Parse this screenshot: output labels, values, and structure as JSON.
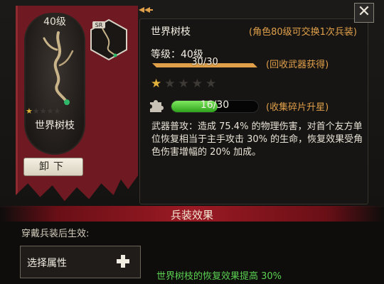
{
  "banner": {
    "level": "40级",
    "name": "世界树枝",
    "stars_on": 1,
    "stars_total": 5,
    "unequip_label": "卸下",
    "rarity": "SR"
  },
  "header": {
    "close_glyph": "✕",
    "item_name": "世界树枝",
    "exchange_note": "(角色80级可交换1次兵装)"
  },
  "stats": {
    "level_label": "等级：40级",
    "level_progress": "30/30",
    "level_fraction": 1.0,
    "recycle_note": "(回收武器获得)",
    "stars_on": 1,
    "stars_total": 5,
    "shard_progress": "16/30",
    "shard_fraction": 0.533,
    "star_up_note": "(收集碎片升星)"
  },
  "description": "武器普攻：造成 75.4% 的物理伤害，对首个友方单位恢复相当于主手攻击 30% 的生命，恢复效果受角色伤害增幅的 20% 加成。",
  "effects": {
    "section_title": "兵装效果",
    "caption": "穿戴兵装后生效:",
    "select_label": "选择属性",
    "bonus_text": "世界树枝的恢复效果提高 30%"
  },
  "colors": {
    "accent_orange": "#e0a04a",
    "banner_red": "#6f1a22",
    "bonus_green": "#5cd152",
    "star_gold": "#e3b23c"
  },
  "icons": {
    "close": "close-icon",
    "puzzle": "puzzle-piece-icon",
    "plus": "plus-icon",
    "branch": "branch-icon"
  }
}
